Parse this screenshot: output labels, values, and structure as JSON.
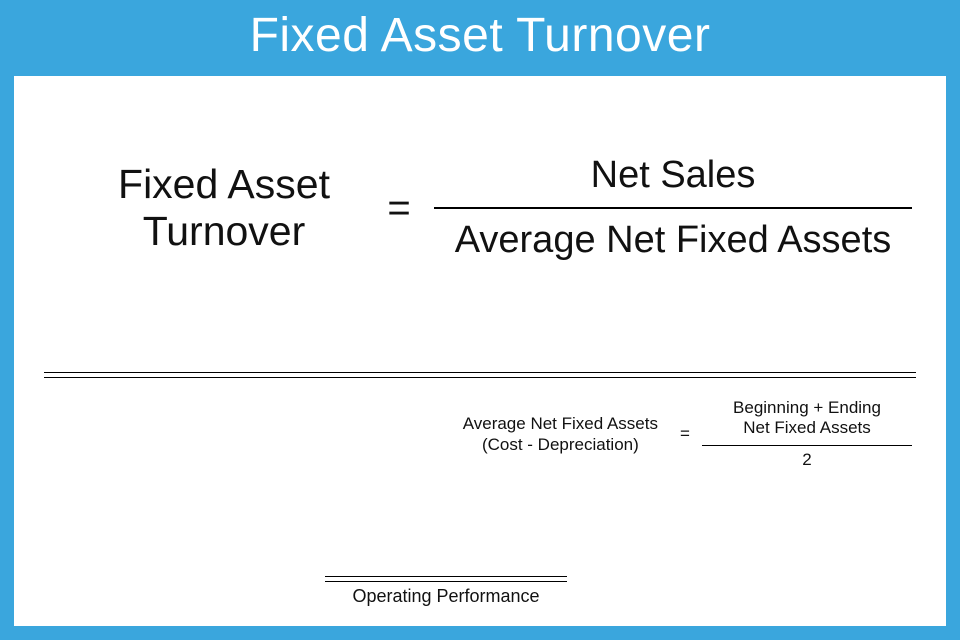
{
  "title": "Fixed Asset Turnover",
  "main_formula": {
    "lhs_line1": "Fixed Asset",
    "lhs_line2": "Turnover",
    "eq": "=",
    "numerator": "Net Sales",
    "denominator": "Average Net Fixed Assets"
  },
  "sub_formula": {
    "lhs_line1": "Average Net Fixed Assets",
    "lhs_line2": "(Cost - Depreciation)",
    "eq": "=",
    "numerator_line1": "Beginning + Ending",
    "numerator_line2": "Net Fixed Assets",
    "denominator": "2"
  },
  "footer": "Operating Performance"
}
